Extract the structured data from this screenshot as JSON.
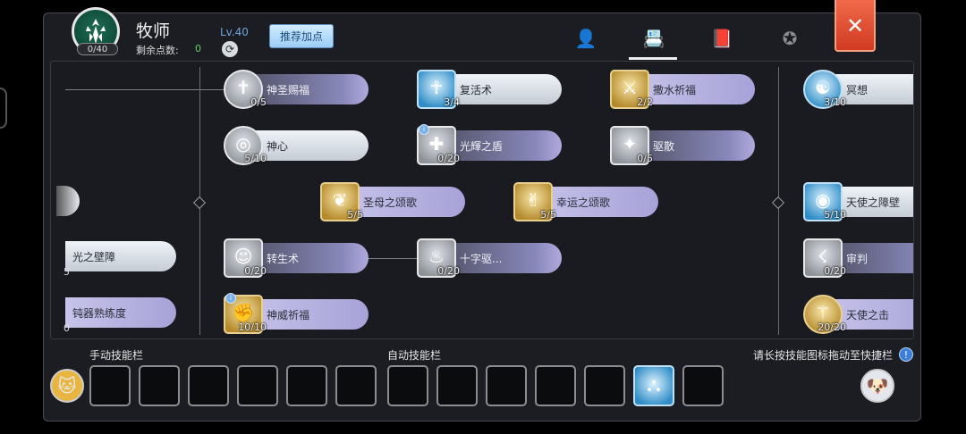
{
  "header": {
    "class_name": "牧师",
    "emblem_count": "0/40",
    "points_label": "剩余点数:",
    "points_value": "0",
    "level": "Lv.40",
    "recommend_label": "推荐加点",
    "close_label": "✕",
    "tabs": [
      {
        "icon": "character-icon",
        "glyph": "👤"
      },
      {
        "icon": "skill-book-icon",
        "glyph": "📇"
      },
      {
        "icon": "notebook-icon",
        "glyph": "📕"
      },
      {
        "icon": "emblem-icon",
        "glyph": "✪"
      }
    ]
  },
  "skills": [
    {
      "name": "神圣赐福",
      "level": "0/5"
    },
    {
      "name": "神心",
      "level": "5/10"
    },
    {
      "name": "复活术",
      "level": "3/4"
    },
    {
      "name": "光輝之盾",
      "level": "0/20"
    },
    {
      "name": "圣母之颂歌",
      "level": "5/5"
    },
    {
      "name": "幸运之颂歌",
      "level": "5/5"
    },
    {
      "name": "转生术",
      "level": "0/20"
    },
    {
      "name": "十字驱...",
      "level": "0/20"
    },
    {
      "name": "神威祈福",
      "level": "10/10"
    },
    {
      "name": "撒水祈福",
      "level": "2/2"
    },
    {
      "name": "驱散",
      "level": "0/5"
    },
    {
      "name": "冥想",
      "level": "3/10"
    },
    {
      "name": "天使之障壁",
      "level": "5/10"
    },
    {
      "name": "审判",
      "level": "0/20"
    },
    {
      "name": "天使之击",
      "level": "20/20"
    },
    {
      "name": "光之壁障",
      "level": "5"
    },
    {
      "name": "钝器熟练度",
      "level": "0"
    }
  ],
  "bottom": {
    "manual_label": "手动技能栏",
    "auto_label": "自动技能栏",
    "hint": "请长按技能图标拖动至快捷栏",
    "hint_icon": "!"
  }
}
